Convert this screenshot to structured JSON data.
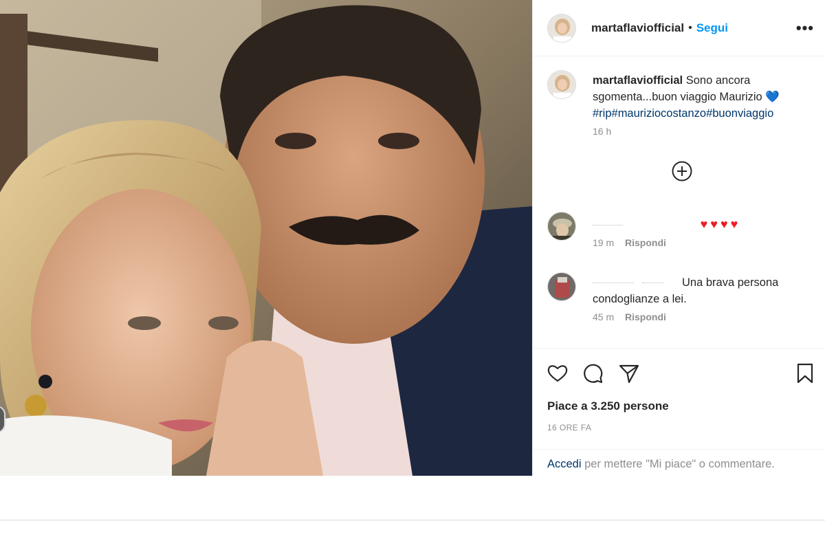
{
  "post": {
    "author": "martaflaviofficial",
    "follow_label": "Segui",
    "separator": "•",
    "more_label": "•••"
  },
  "caption": {
    "user": "martaflaviofficial",
    "text": "Sono ancora sgomenta...buon viaggio Maurizio",
    "emoji": "💙",
    "hashtags": "#rip#mauriziocostanzo#buonviaggio",
    "time": "16 h"
  },
  "comments": [
    {
      "hearts": "♥♥♥♥",
      "time": "19 m",
      "reply_label": "Rispondi"
    },
    {
      "text": "Una brava persona condoglianze a lei.",
      "time": "45 m",
      "reply_label": "Rispondi"
    }
  ],
  "actions": {
    "icons": [
      "heart-icon",
      "comment-icon",
      "share-icon",
      "bookmark-icon"
    ],
    "likes_text": "Piace a 3.250 persone",
    "timestamp": "16 ORE FA"
  },
  "login_prompt": {
    "link": "Accedi",
    "text": " per mettere \"Mi piace\" o commentare."
  },
  "colors": {
    "accent": "#0095f6",
    "hashtag": "#00376b",
    "muted": "#8e8e8e",
    "heart_red": "#ed1c24",
    "heart_blue": "#3b8fd9"
  }
}
